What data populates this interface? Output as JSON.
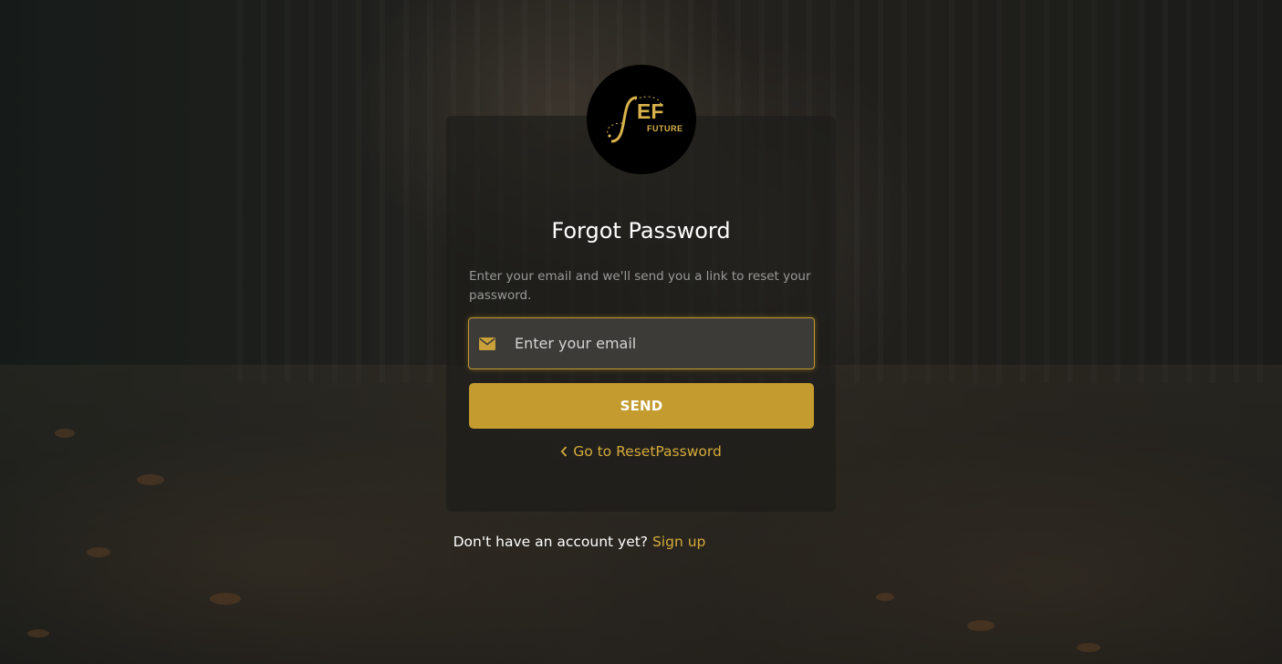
{
  "brand": {
    "logo_letters": "EF",
    "logo_subtitle": "FUTURE"
  },
  "form": {
    "title": "Forgot Password",
    "description": "Enter your email and we'll send you a link to reset your password.",
    "email_placeholder": "Enter your email",
    "email_value": "",
    "send_label": "SEND",
    "back_link_label": "Go to ResetPassword"
  },
  "footer": {
    "signup_prompt": "Don't have an account yet?",
    "signup_link_label": "Sign up"
  },
  "icons": {
    "email_field": "envelope-icon",
    "back_link": "chevron-left-icon"
  },
  "colors": {
    "accent": "#c49b2f",
    "link": "#d6aa3a",
    "logo_bg": "#000000"
  }
}
